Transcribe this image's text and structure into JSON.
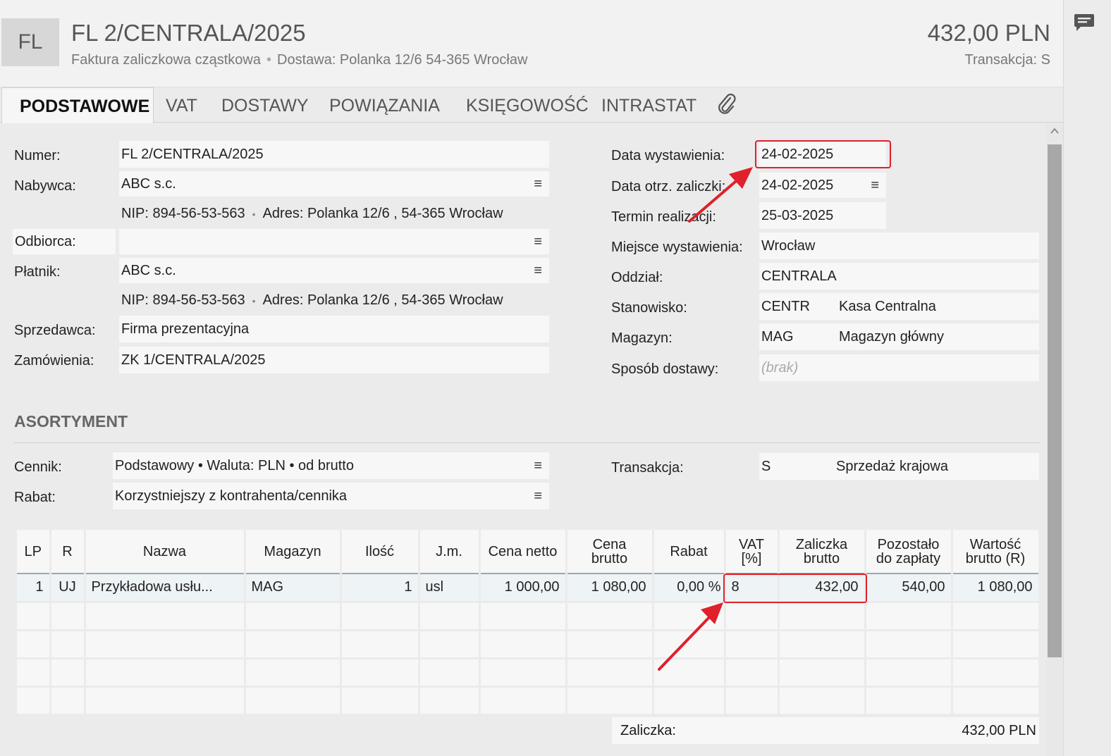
{
  "header": {
    "badge": "FL",
    "title": "FL 2/CENTRALA/2025",
    "subtitle_type": "Faktura zaliczkowa cząstkowa",
    "subtitle_sep": "•",
    "subtitle_delivery": "Dostawa: Polanka  12/6  54-365 Wrocław",
    "amount": "432,00 PLN",
    "transaction": "Transakcja:  S"
  },
  "tabs": [
    {
      "label": "PODSTAWOWE"
    },
    {
      "label": "VAT"
    },
    {
      "label": "DOSTAWY"
    },
    {
      "label": "POWIĄZANIA"
    },
    {
      "label": "KSIĘGOWOŚĆ"
    },
    {
      "label": "INTRASTAT"
    }
  ],
  "left": {
    "numer_label": "Numer:",
    "numer_value": "FL 2/CENTRALA/2025",
    "nabywca_label": "Nabywca:",
    "nabywca_value": "ABC s.c.",
    "nabywca_nip": "NIP:  894-56-53-563",
    "nabywca_addr": "Adres:  Polanka  12/6 , 54-365 Wrocław",
    "odbiorca_label": "Odbiorca:",
    "odbiorca_value": "",
    "platnik_label": "Płatnik:",
    "platnik_value": "ABC s.c.",
    "platnik_nip": "NIP:  894-56-53-563",
    "platnik_addr": "Adres:  Polanka  12/6 , 54-365 Wrocław",
    "sprzedawca_label": "Sprzedawca:",
    "sprzedawca_value": "Firma prezentacyjna",
    "zamowienia_label": "Zamówienia:",
    "zamowienia_value": "ZK 1/CENTRALA/2025",
    "dot": "•"
  },
  "right": {
    "data_wyst_label": "Data wystawienia:",
    "data_wyst_value": "24-02-2025",
    "data_otrz_label": "Data otrz. zaliczki:",
    "data_otrz_value": "24-02-2025",
    "termin_label": "Termin realizacji:",
    "termin_value": "25-03-2025",
    "miejsce_label": "Miejsce wystawienia:",
    "miejsce_value": "Wrocław",
    "oddzial_label": "Oddział:",
    "oddzial_value": "CENTRALA",
    "stanowisko_label": "Stanowisko:",
    "stanowisko_code": "CENTR",
    "stanowisko_name": "Kasa Centralna",
    "magazyn_label": "Magazyn:",
    "magazyn_code": "MAG",
    "magazyn_name": "Magazyn główny",
    "sposob_label": "Sposób dostawy:",
    "sposob_value": "(brak)"
  },
  "assortment": {
    "title": "ASORTYMENT",
    "cennik_label": "Cennik:",
    "cennik_value": "Podstawowy • Waluta: PLN • od brutto",
    "rabat_label": "Rabat:",
    "rabat_value": "Korzystniejszy z kontrahenta/cennika",
    "transakcja_label": "Transakcja:",
    "transakcja_code": "S",
    "transakcja_name": "Sprzedaż krajowa"
  },
  "table": {
    "headers": [
      "LP",
      "R",
      "Nazwa",
      "Magazyn",
      "Ilość",
      "J.m.",
      "Cena netto",
      "Cena\nbrutto",
      "Rabat",
      "VAT\n[%]",
      "Zaliczka\nbrutto",
      "Pozostało\ndo zapłaty",
      "Wartość\nbrutto (R)"
    ],
    "rows": [
      [
        "1",
        "UJ",
        "Przykładowa usłu...",
        "MAG",
        "1",
        "usl",
        "1 000,00",
        "1 080,00",
        "0,00 %",
        "8",
        "432,00",
        "540,00",
        "1 080,00"
      ]
    ]
  },
  "footer": {
    "zaliczka_label": "Zaliczka:",
    "zaliczka_value": "432,00 PLN"
  },
  "icons": {
    "menu": "≡",
    "chat": "chat-icon",
    "clip": "paperclip-icon"
  },
  "colors": {
    "highlight": "#e0202a"
  }
}
